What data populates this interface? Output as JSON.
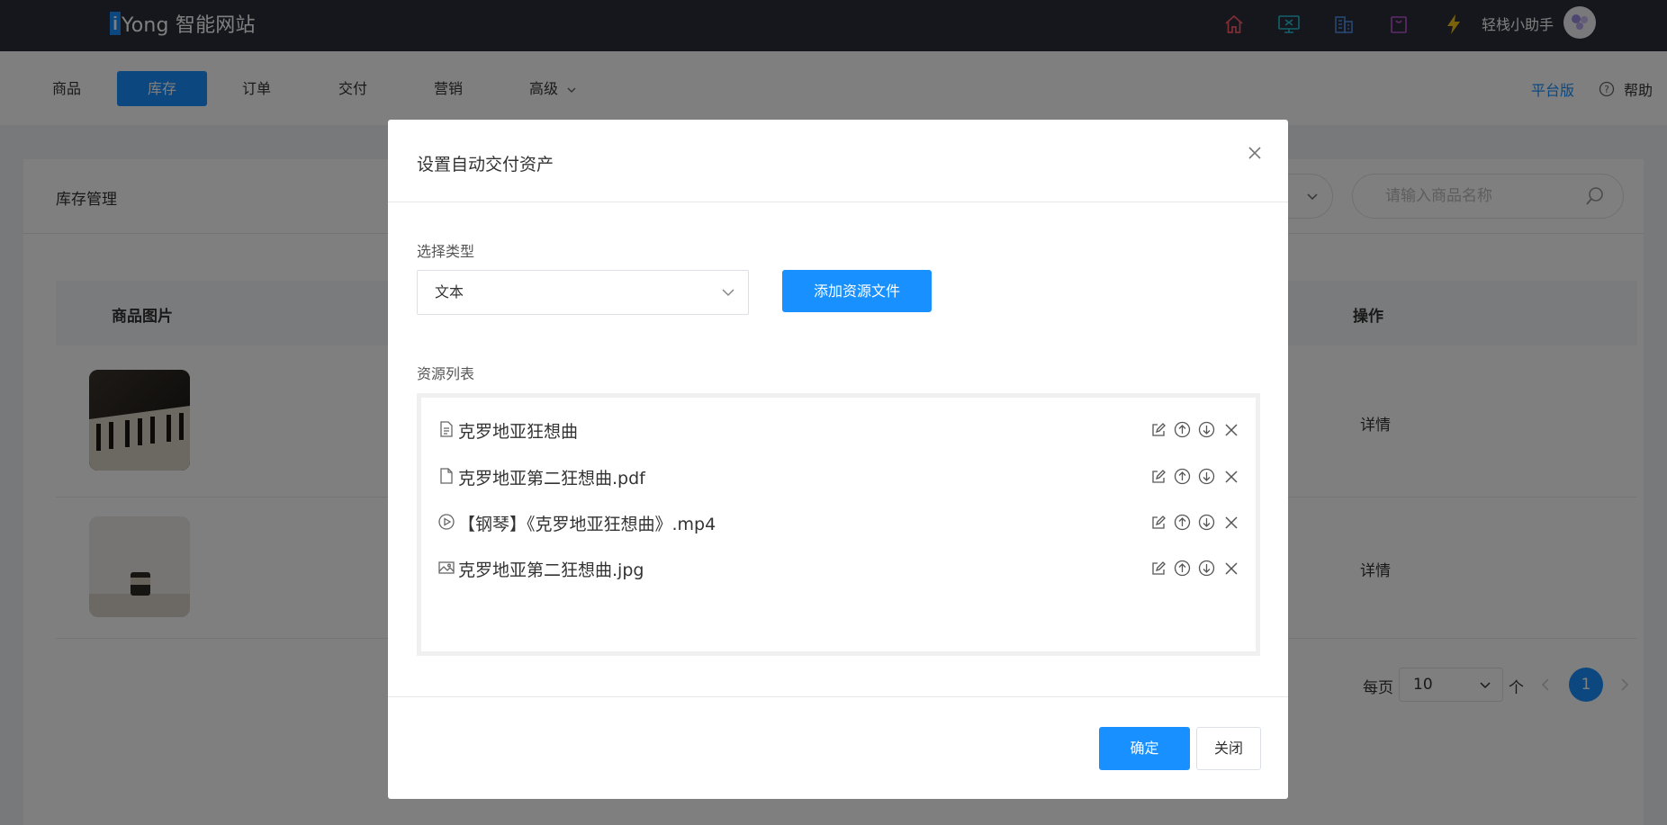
{
  "header": {
    "brand_letter": "i",
    "brand_name": "Yong 智能网站",
    "icons": [
      "home-icon",
      "monitor-icon",
      "building-icon",
      "bag-icon",
      "lightning-icon"
    ],
    "assistant_label": "轻栈小助手"
  },
  "nav": {
    "items": [
      "商品",
      "库存",
      "订单",
      "交付",
      "营销",
      "高级"
    ],
    "active": "库存",
    "platform_label": "平台版",
    "help_label": "帮助"
  },
  "page": {
    "title": "库存管理",
    "search_placeholder": "请输入商品名称",
    "columns": [
      "商品图片",
      "操作"
    ],
    "rows": [
      {
        "action": "详情"
      },
      {
        "action": "详情"
      }
    ],
    "pagination": {
      "per_page_label": "每页",
      "per_page_value": "10",
      "unit": "个",
      "current_page": "1"
    }
  },
  "modal": {
    "title": "设置自动交付资产",
    "type_label": "选择类型",
    "type_value": "文本",
    "add_button": "添加资源文件",
    "list_label": "资源列表",
    "resources": [
      {
        "icon": "text-file-icon",
        "name": "克罗地亚狂想曲"
      },
      {
        "icon": "pdf-file-icon",
        "name": "克罗地亚第二狂想曲.pdf"
      },
      {
        "icon": "video-play-icon",
        "name": "【钢琴】《克罗地亚狂想曲》.mp4"
      },
      {
        "icon": "image-icon",
        "name": "克罗地亚第二狂想曲.jpg"
      }
    ],
    "confirm_button": "确定",
    "close_button": "关闭"
  },
  "colors": {
    "primary": "#1890ff",
    "topbar": "#2b2f3a"
  }
}
